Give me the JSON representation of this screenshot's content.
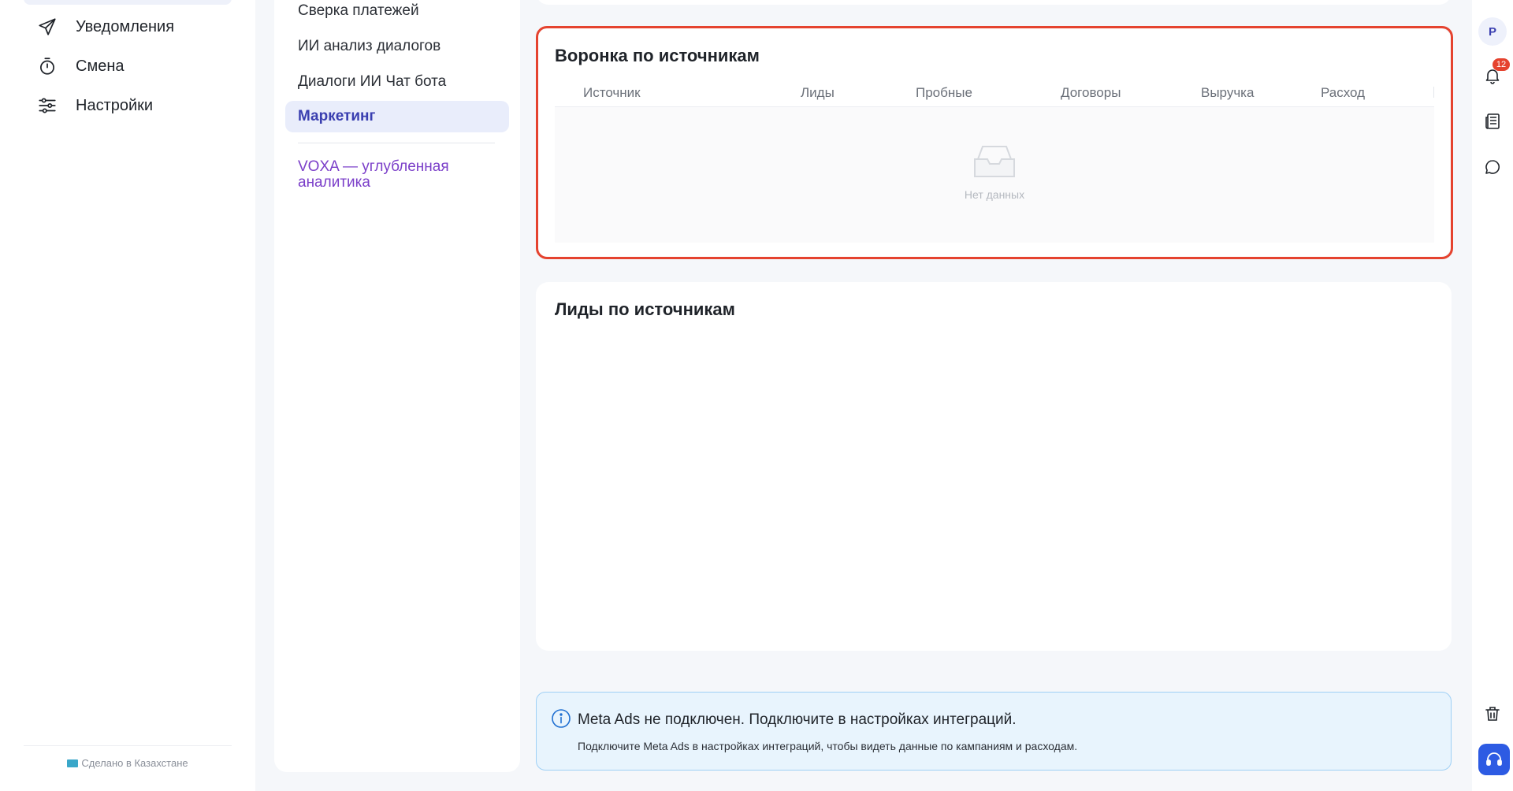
{
  "sidebar": {
    "items": [
      {
        "label": "Уведомления",
        "icon": "send-icon"
      },
      {
        "label": "Смена",
        "icon": "stopwatch-icon"
      },
      {
        "label": "Настройки",
        "icon": "sliders-icon"
      }
    ],
    "footer": "Сделано в Казахстане"
  },
  "submenu": {
    "items": [
      {
        "label": "Сверка платежей"
      },
      {
        "label": "ИИ анализ диалогов"
      },
      {
        "label": "Диалоги ИИ Чат бота"
      },
      {
        "label": "Маркетинг",
        "active": true
      }
    ],
    "link": "VOXA — углубленная аналитика"
  },
  "funnel": {
    "title": "Воронка по источникам",
    "columns": [
      "Источник",
      "Лиды",
      "Пробные",
      "Договоры",
      "Выручка",
      "Расход"
    ],
    "empty_text": "Нет данных"
  },
  "leads": {
    "title": "Лиды по источникам"
  },
  "alert": {
    "title": "Meta Ads не подключен. Подключите в настройках интеграций.",
    "description": "Подключите Meta Ads в настройках интеграций, чтобы видеть данные по кампаниям и расходам."
  },
  "rail": {
    "avatar_initial": "P",
    "notification_count": "12"
  },
  "colors": {
    "accent": "#3a3fb0",
    "highlight": "#e5432f",
    "link": "#7b3fc9",
    "info_bg": "#e8f4fd",
    "support": "#2d5be3"
  }
}
